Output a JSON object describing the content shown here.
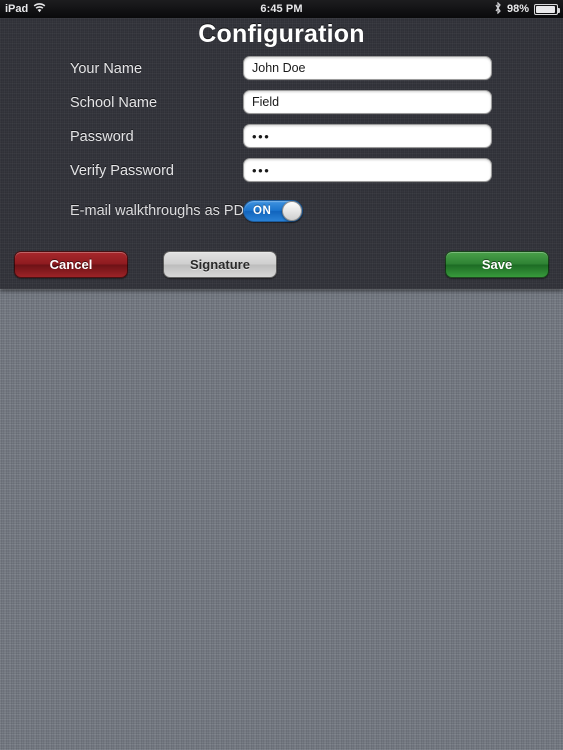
{
  "status_bar": {
    "device": "iPad",
    "wifi_icon": "wifi-icon",
    "time": "6:45 PM",
    "bluetooth_icon": "bluetooth-icon",
    "battery_percent": "98%",
    "battery_icon": "battery-icon"
  },
  "header": {
    "title": "Configuration"
  },
  "form": {
    "fields": [
      {
        "label": "Your Name",
        "value": "John Doe",
        "type": "text"
      },
      {
        "label": "School Name",
        "value": "Field",
        "type": "text"
      },
      {
        "label": "Password",
        "value": "•••",
        "type": "password"
      },
      {
        "label": "Verify Password",
        "value": "•••",
        "type": "password"
      }
    ],
    "toggle": {
      "label": "E-mail walkthroughs as PDF",
      "state_label": "ON",
      "on": true
    }
  },
  "buttons": {
    "cancel": "Cancel",
    "signature": "Signature",
    "save": "Save"
  },
  "colors": {
    "panel_bg": "#32333a",
    "content_bg": "#71767f",
    "toggle_on": "#1b74cd",
    "cancel_red": "#8e1b20",
    "save_green": "#2e8233",
    "signature_gray": "#cfcfcf",
    "title_text": "#ffffff"
  }
}
